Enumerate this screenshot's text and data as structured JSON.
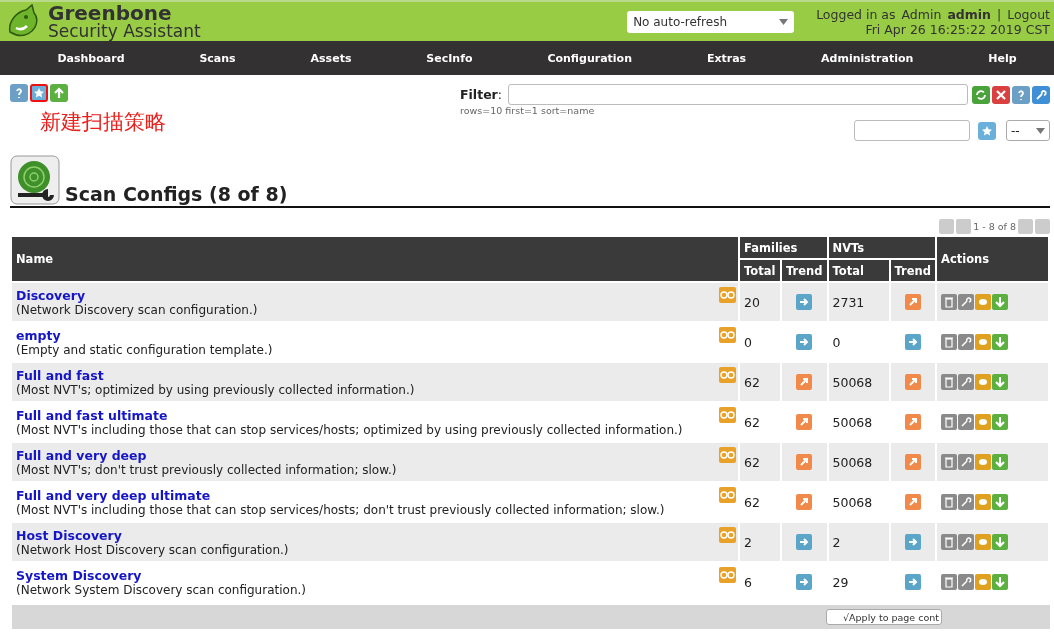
{
  "brand": {
    "name": "Greenbone",
    "subtitle": "Security Assistant"
  },
  "refresh": {
    "value": "No auto-refresh"
  },
  "session": {
    "prefix": "Logged in as",
    "role": "Admin",
    "user": "admin",
    "separator": "|",
    "logout": "Logout",
    "datetime": "Fri Apr 26 16:25:22 2019 CST"
  },
  "nav": [
    "Dashboard",
    "Scans",
    "Assets",
    "SecInfo",
    "Configuration",
    "Extras",
    "Administration",
    "Help"
  ],
  "toolbar": {
    "highlighted": true,
    "annotation": "新建扫描策略"
  },
  "filter": {
    "label": "Filter",
    "colon": ":",
    "summary": "rows=10 first=1 sort=name",
    "select_value": "--"
  },
  "title": "Scan Configs (8 of 8)",
  "pagination": "1 - 8 of 8",
  "table": {
    "columns": {
      "name": "Name",
      "families": "Families",
      "nvts": "NVTs",
      "families_total": "Total",
      "families_trend": "Trend",
      "nvts_total": "Total",
      "nvts_trend": "Trend",
      "actions": "Actions"
    },
    "rows": [
      {
        "name": "Discovery",
        "comment": "(Network Discovery scan configuration.)",
        "families": "20",
        "families_rising": false,
        "nvts": "2731",
        "nvts_rising": true
      },
      {
        "name": "empty",
        "comment": "(Empty and static configuration template.)",
        "families": "0",
        "families_rising": false,
        "nvts": "0",
        "nvts_rising": false
      },
      {
        "name": "Full and fast",
        "comment": "(Most NVT's; optimized by using previously collected information.)",
        "families": "62",
        "families_rising": true,
        "nvts": "50068",
        "nvts_rising": true
      },
      {
        "name": "Full and fast ultimate",
        "comment": "(Most NVT's including those that can stop services/hosts; optimized by using previously collected information.)",
        "families": "62",
        "families_rising": true,
        "nvts": "50068",
        "nvts_rising": true
      },
      {
        "name": "Full and very deep",
        "comment": "(Most NVT's; don't trust previously collected information; slow.)",
        "families": "62",
        "families_rising": true,
        "nvts": "50068",
        "nvts_rising": true
      },
      {
        "name": "Full and very deep ultimate",
        "comment": "(Most NVT's including those that can stop services/hosts; don't trust previously collected information; slow.)",
        "families": "62",
        "families_rising": true,
        "nvts": "50068",
        "nvts_rising": true
      },
      {
        "name": "Host Discovery",
        "comment": "(Network Host Discovery scan configuration.)",
        "families": "2",
        "families_rising": false,
        "nvts": "2",
        "nvts_rising": false
      },
      {
        "name": "System Discovery",
        "comment": "(Network System Discovery scan configuration.)",
        "families": "6",
        "families_rising": false,
        "nvts": "29",
        "nvts_rising": false
      }
    ]
  },
  "apply_button": "√Apply to page cont"
}
